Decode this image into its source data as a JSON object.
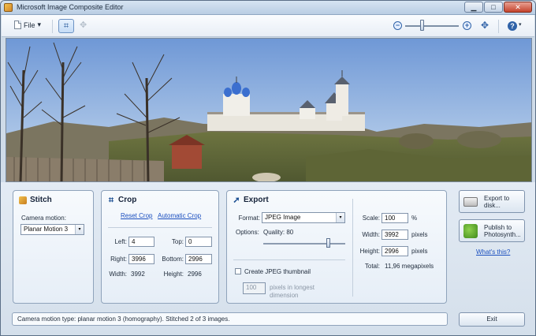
{
  "window": {
    "title": "Microsoft Image Composite Editor",
    "minimize_glyph": "▁",
    "maximize_glyph": "□",
    "close_glyph": "✕"
  },
  "toolbar": {
    "file_label": "File",
    "crop_tool_icon": "crop-icon",
    "zoom_out_glyph": "−",
    "zoom_in_glyph": "+",
    "fit_glyph": "✥",
    "help_glyph": "?",
    "dropdown_glyph": "▾"
  },
  "stitch": {
    "title": "Stitch",
    "camera_motion_label": "Camera motion:",
    "camera_motion_value": "Planar Motion 3"
  },
  "crop": {
    "title": "Crop",
    "reset_link": "Reset Crop",
    "automatic_link": "Automatic Crop",
    "left_label": "Left:",
    "left_value": "4",
    "top_label": "Top:",
    "top_value": "0",
    "right_label": "Right:",
    "right_value": "3996",
    "bottom_label": "Bottom:",
    "bottom_value": "2996",
    "width_label": "Width:",
    "width_value": "3992",
    "height_label": "Height:",
    "height_value": "2996"
  },
  "export": {
    "title": "Export",
    "format_label": "Format:",
    "format_value": "JPEG Image",
    "options_label": "Options:",
    "quality_label": "Quality: 80",
    "quality_value": 80,
    "thumbnail_label": "Create JPEG thumbnail",
    "thumbnail_checked": false,
    "thumbnail_pixels_value": "100",
    "thumbnail_pixels_label_1": "pixels in longest",
    "thumbnail_pixels_label_2": "dimension",
    "scale_label": "Scale:",
    "scale_value": "100",
    "scale_unit": "%",
    "width_label": "Width:",
    "width_value": "3992",
    "width_unit": "pixels",
    "height_label": "Height:",
    "height_value": "2996",
    "height_unit": "pixels",
    "total_label": "Total:",
    "total_value": "11,96 megapixels"
  },
  "actions": {
    "export_to_disk_line1": "Export to",
    "export_to_disk_line2": "disk...",
    "publish_line1": "Publish to",
    "publish_line2": "Photosynth...",
    "whats_this_link": "What's this?",
    "exit_label": "Exit"
  },
  "status": {
    "text": "Camera motion type: planar motion 3 (homography). Stitched 2 of 3 images."
  },
  "colors": {
    "accent": "#1a4e92",
    "link": "#1b4fbf",
    "sky_top": "#6f98d6",
    "sky_bottom": "#c8dbef"
  }
}
